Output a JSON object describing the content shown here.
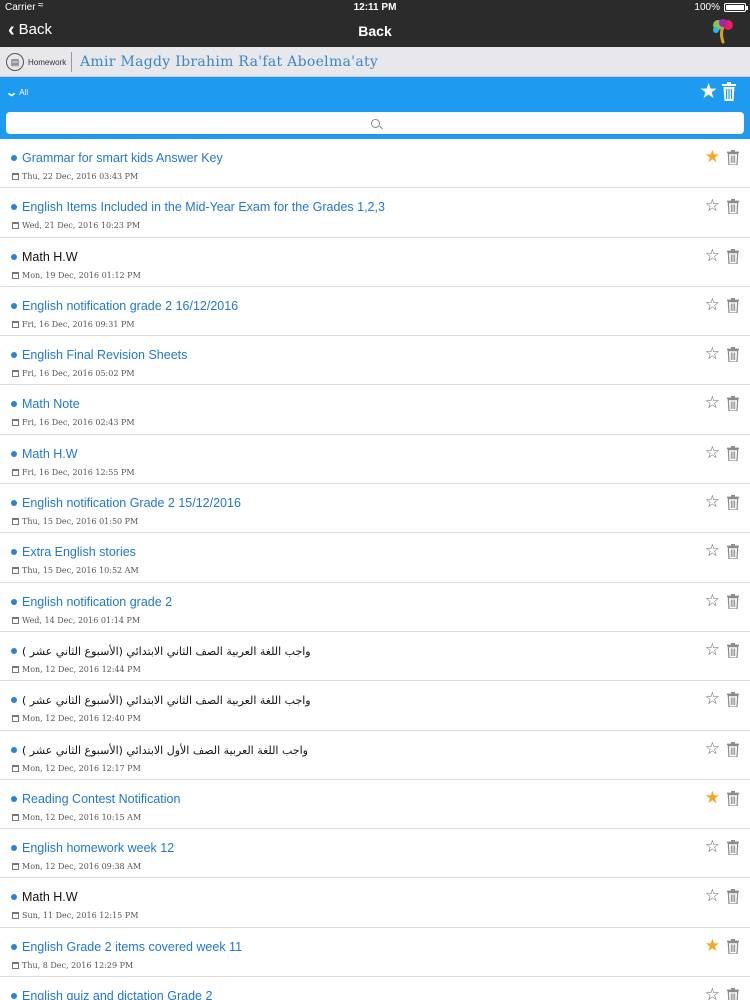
{
  "status_bar": {
    "carrier": "Carrier",
    "time": "12:11 PM",
    "battery": "100%"
  },
  "nav": {
    "back_label": "Back",
    "title": "Back"
  },
  "sub_header": {
    "section": "Homework",
    "student_name": "Amir Magdy Ibrahim Ra'fat Aboelma'aty"
  },
  "filter": {
    "label": "All"
  },
  "search": {
    "placeholder": "",
    "value": ""
  },
  "colors": {
    "accent": "#1e9af0",
    "nav_bg": "#2b2b2b",
    "link": "#1f78cc",
    "favorite": "#f5a623"
  },
  "items": [
    {
      "title": "Grammar for smart kids Answer Key",
      "date": "Thu, 22 Dec, 2016 03:43 PM",
      "starred": true,
      "style": "link"
    },
    {
      "title": "English Items Included in the Mid-Year Exam for the Grades 1,2,3",
      "date": "Wed, 21 Dec, 2016 10:23 PM",
      "starred": false,
      "style": "link"
    },
    {
      "title": "Math H.W",
      "date": "Mon, 19 Dec, 2016 01:12 PM",
      "starred": false,
      "style": "dark"
    },
    {
      "title": "English notification grade 2 16/12/2016",
      "date": "Fri, 16 Dec, 2016 09:31 PM",
      "starred": false,
      "style": "link"
    },
    {
      "title": "English Final Revision Sheets",
      "date": "Fri, 16 Dec, 2016 05:02 PM",
      "starred": false,
      "style": "link"
    },
    {
      "title": "Math Note",
      "date": "Fri, 16 Dec, 2016 02:43 PM",
      "starred": false,
      "style": "link"
    },
    {
      "title": "Math H.W",
      "date": "Fri, 16 Dec, 2016 12:55 PM",
      "starred": false,
      "style": "link"
    },
    {
      "title": "English notification Grade 2 15/12/2016",
      "date": "Thu, 15 Dec, 2016 01:50 PM",
      "starred": false,
      "style": "link"
    },
    {
      "title": "Extra English stories",
      "date": "Thu, 15 Dec, 2016 10:52 AM",
      "starred": false,
      "style": "link"
    },
    {
      "title": "English notification grade 2",
      "date": "Wed, 14 Dec, 2016 01:14 PM",
      "starred": false,
      "style": "link"
    },
    {
      "title": "واجب اللغة العربية الصف الثاني الابتدائي (الأسبوع الثاني عشر )",
      "date": "Mon, 12 Dec, 2016 12:44 PM",
      "starred": false,
      "style": "rtl"
    },
    {
      "title": "واجب اللغة العربية الصف الثاني الابتدائي (الأسبوع الثاني عشر )",
      "date": "Mon, 12 Dec, 2016 12:40 PM",
      "starred": false,
      "style": "rtl"
    },
    {
      "title": "واجب اللغة العربية الصف الأول الابتدائي (الأسبوع الثاني عشر )",
      "date": "Mon, 12 Dec, 2016 12:17 PM",
      "starred": false,
      "style": "rtl"
    },
    {
      "title": "Reading Contest Notification",
      "date": "Mon, 12 Dec, 2016 10:15 AM",
      "starred": true,
      "style": "link"
    },
    {
      "title": "English homework week 12",
      "date": "Mon, 12 Dec, 2016 09:38 AM",
      "starred": false,
      "style": "link"
    },
    {
      "title": "Math H.W",
      "date": "Sun, 11 Dec, 2016 12:15 PM",
      "starred": false,
      "style": "dark"
    },
    {
      "title": "English Grade 2 items covered week 11",
      "date": "Thu, 8 Dec, 2016 12:29 PM",
      "starred": true,
      "style": "link"
    },
    {
      "title": "English quiz and dictation Grade 2",
      "date": "",
      "starred": false,
      "style": "link"
    }
  ]
}
